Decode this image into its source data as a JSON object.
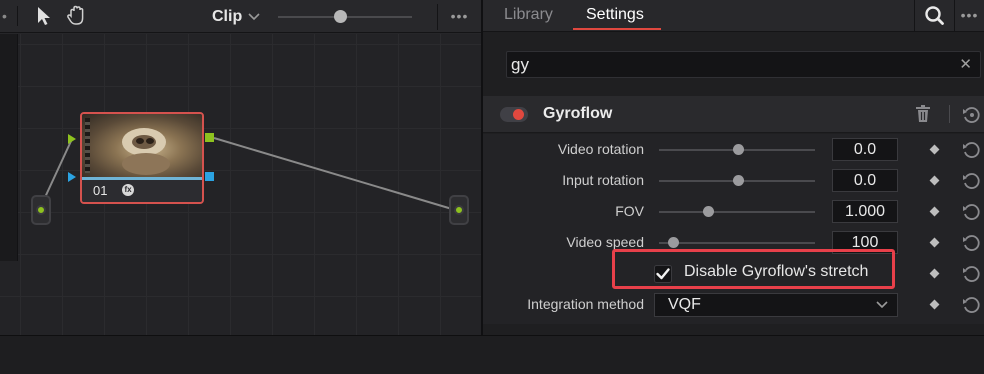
{
  "node_editor": {
    "toolbar": {
      "clip_label": "Clip",
      "more_glyph": "•••",
      "left_glyph": "•",
      "icons": [
        "pointer-arrow-icon",
        "hand-pan-icon",
        "chevron-down-icon"
      ]
    },
    "clip_node": {
      "number": "01",
      "fx_glyph": "fx",
      "colors": {
        "border": "#d5524e",
        "progress": "#6fb4d6"
      }
    },
    "ports": {
      "rgb_color": "#8ec21f",
      "alpha_color": "#2ba3e2"
    }
  },
  "inspector": {
    "tabs": [
      {
        "label": "Library",
        "active": false
      },
      {
        "label": "Settings",
        "active": true
      }
    ],
    "more_glyph": "•••",
    "search": {
      "value": "gy",
      "clear_glyph": "✕"
    },
    "section": {
      "title": "Gyroflow",
      "enabled": true,
      "accent_color": "#e0483f"
    },
    "params": [
      {
        "label": "Video rotation",
        "value": "0.0",
        "slider_fraction": 0.51
      },
      {
        "label": "Input rotation",
        "value": "0.0",
        "slider_fraction": 0.51
      },
      {
        "label": "FOV",
        "value": "1.000",
        "slider_fraction": 0.32
      },
      {
        "label": "Video speed",
        "value": "100",
        "slider_fraction": 0.09
      }
    ],
    "checkbox": {
      "label": "Disable Gyroflow's stretch",
      "checked": true,
      "check_glyph": "✔"
    },
    "integration": {
      "label": "Integration method",
      "value": "VQF"
    },
    "highlight_color": "#e8404a"
  }
}
